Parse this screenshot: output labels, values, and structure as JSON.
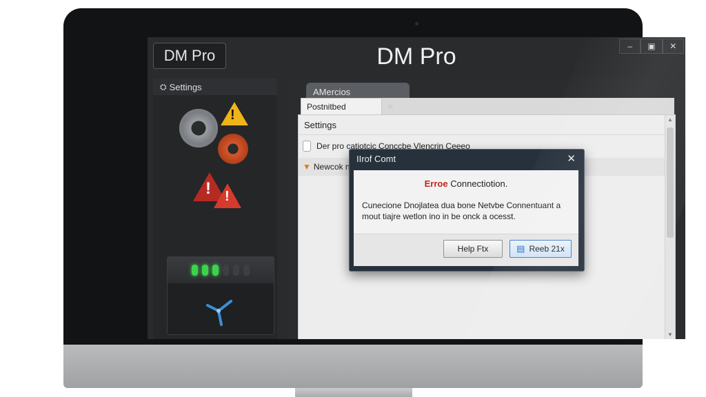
{
  "window": {
    "app_badge": "DM Pro",
    "title": "DM Pro",
    "controls": {
      "minimize": "–",
      "maximize": "▣",
      "close": "✕"
    }
  },
  "sidebar": {
    "header_label": "Settings",
    "header_icon": "settings-icon",
    "status_leds": {
      "lit": 3,
      "total": 6
    }
  },
  "main": {
    "tabs": [
      {
        "label": "AMercios"
      },
      {
        "label": "Postnitbed"
      }
    ],
    "panel": {
      "section_label": "Settings",
      "description_row": "Der pro catiotcic Conccbe Vlencrin Ceeeo",
      "network_row": "Newcok ne"
    }
  },
  "dialog": {
    "title": "IIrof Comt",
    "heading_error": "Erroe",
    "heading_rest": "Connectiotion.",
    "message": "Cunecione Dnojlatea dua bone Netvbe Connentuant a mout tiajre wetlon ino in be onck  a ocesst.",
    "buttons": {
      "help": "Help Ftx",
      "reset": "Reeb 21x"
    },
    "colors": {
      "error": "#c0251f",
      "primary_border": "#3d7bc7"
    }
  },
  "colors": {
    "bezel": "#121314",
    "screen": "#2a2b2d",
    "led_on": "#3cd34c"
  }
}
